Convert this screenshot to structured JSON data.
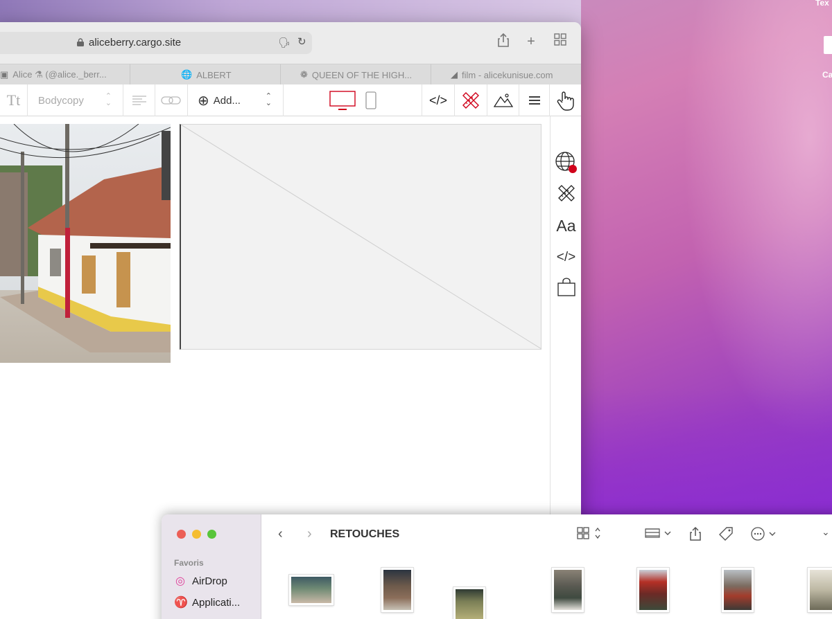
{
  "browser": {
    "url": "aliceberry.cargo.site",
    "tabs": [
      {
        "label": "Alice ⚗ (@alice._berr...",
        "icon": "instagram-icon"
      },
      {
        "label": "ALBERT",
        "icon": "globe-icon"
      },
      {
        "label": "QUEEN OF THE HIGH...",
        "icon": "site-favicon-icon"
      },
      {
        "label": "film - alicekunisue.com",
        "icon": "mountain-favicon-icon"
      }
    ]
  },
  "cargo_toolbar": {
    "text_style_icon": "Tt",
    "paragraph_style": "Bodycopy",
    "add_label": "Add...",
    "code_label": "</>",
    "side_text_label": "Aa",
    "side_code_label": "</>"
  },
  "desktop": {
    "label_top": "Tex",
    "label_side": "Ca"
  },
  "finder": {
    "sidebar_heading": "Favoris",
    "items": [
      {
        "label": "AirDrop",
        "icon": "airdrop-icon"
      },
      {
        "label": "Applicati...",
        "icon": "applications-icon"
      }
    ],
    "title": "RETOUCHES"
  },
  "colors": {
    "accent_red": "#d0021b",
    "placeholder_bg": "#f2f2f2"
  }
}
